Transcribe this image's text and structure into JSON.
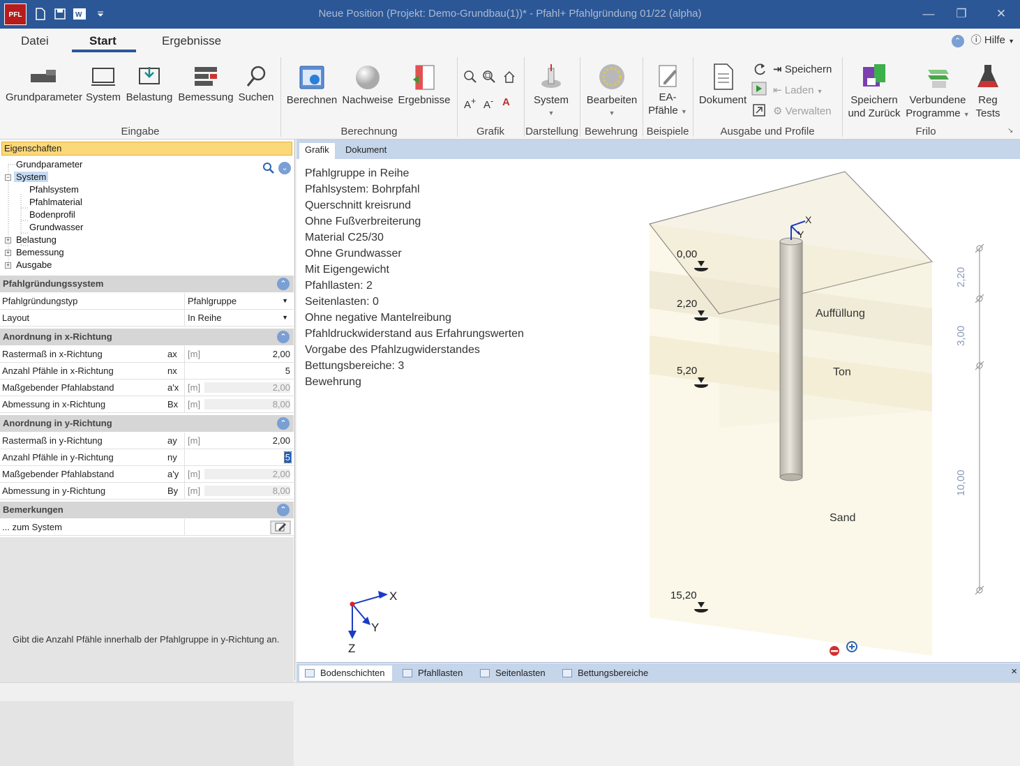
{
  "app": {
    "logo": "PFL",
    "title": "Neue Position (Projekt: Demo-Grundbau(1))* - Pfahl+ Pfahlgründung 01/22 (alpha)"
  },
  "menu": {
    "tabs": [
      "Datei",
      "Start",
      "Ergebnisse"
    ],
    "active": "Start",
    "help": "Hilfe"
  },
  "ribbon": {
    "eingabe": {
      "group": "Eingabe",
      "buttons": [
        "Grundparameter",
        "System",
        "Belastung",
        "Bemessung",
        "Suchen"
      ]
    },
    "berechnung": {
      "group": "Berechnung",
      "buttons": [
        "Berechnen",
        "Nachweise",
        "Ergebnisse"
      ]
    },
    "grafik": {
      "group": "Grafik"
    },
    "darstellung": {
      "group": "Darstellung",
      "button": "System"
    },
    "bewehrung": {
      "group": "Bewehrung",
      "button": "Bearbeiten"
    },
    "beispiele": {
      "group": "Beispiele",
      "button_line1": "EA-",
      "button_line2": "Pfähle"
    },
    "ausgabe": {
      "group": "Ausgabe und Profile",
      "dokument": "Dokument",
      "speichern": "Speichern",
      "laden": "Laden",
      "verwalten": "Verwalten"
    },
    "frilo": {
      "group": "Frilo",
      "b1_line1": "Speichern",
      "b1_line2": "und Zurück",
      "b2_line1": "Verbundene",
      "b2_line2": "Programme",
      "b3_line1": "Reg",
      "b3_line2": "Tests"
    }
  },
  "panel": {
    "header": "Eigenschaften",
    "tree": {
      "grundparameter": "Grundparameter",
      "system": "System",
      "pfahlsystem": "Pfahlsystem",
      "pfahlmaterial": "Pfahlmaterial",
      "bodenprofil": "Bodenprofil",
      "grundwasser": "Grundwasser",
      "belastung": "Belastung",
      "bemessung": "Bemessung",
      "ausgabe": "Ausgabe"
    },
    "sections": {
      "system": "Pfahlgründungssystem",
      "x": "Anordnung in x-Richtung",
      "y": "Anordnung in y-Richtung",
      "bem": "Bemerkungen"
    },
    "system_rows": [
      {
        "label": "Pfahlgründungstyp",
        "value": "Pfahlgruppe"
      },
      {
        "label": "Layout",
        "value": "In Reihe"
      }
    ],
    "x_rows": [
      {
        "label": "Rastermaß in x-Richtung",
        "sym": "ax",
        "unit": "[m]",
        "value": "2,00"
      },
      {
        "label": "Anzahl Pfähle in x-Richtung",
        "sym": "nx",
        "unit": "",
        "value": "5"
      },
      {
        "label": "Maßgebender Pfahlabstand",
        "sym": "a'x",
        "unit": "[m]",
        "value": "2,00"
      },
      {
        "label": "Abmessung in x-Richtung",
        "sym": "Bx",
        "unit": "[m]",
        "value": "8,00"
      }
    ],
    "y_rows": [
      {
        "label": "Rastermaß in y-Richtung",
        "sym": "ay",
        "unit": "[m]",
        "value": "2,00"
      },
      {
        "label": "Anzahl Pfähle in y-Richtung",
        "sym": "ny",
        "unit": "",
        "value": "5"
      },
      {
        "label": "Maßgebender Pfahlabstand",
        "sym": "a'y",
        "unit": "[m]",
        "value": "2,00"
      },
      {
        "label": "Abmessung in y-Richtung",
        "sym": "By",
        "unit": "[m]",
        "value": "8,00"
      }
    ],
    "bem_row": "... zum System",
    "hint": "Gibt die Anzahl Pfähle innerhalb der Pfahlgruppe in y-Richtung an."
  },
  "graphic": {
    "tabs": [
      "Grafik",
      "Dokument"
    ],
    "props": [
      "Pfahlgruppe in Reihe",
      "Pfahlsystem: Bohrpfahl",
      "Querschnitt kreisrund",
      "Ohne Fußverbreiterung",
      "Material C25/30",
      "Ohne Grundwasser",
      "Mit Eigengewicht",
      "Pfahllasten: 2",
      "Seitenlasten: 0",
      "Ohne negative Mantelreibung",
      "Pfahldruckwiderstand aus Erfahrungswerten",
      "Vorgabe des Pfahlzugwiderstandes",
      "Bettungsbereiche: 3",
      "Bewehrung"
    ],
    "depths": [
      "0,00",
      "2,20",
      "5,20",
      "15,20"
    ],
    "layers": [
      "Auffüllung",
      "Ton",
      "Sand"
    ],
    "dims": [
      "2,20",
      "3,00",
      "10,00"
    ],
    "axes": {
      "x": "X",
      "y": "Y",
      "z": "Z"
    }
  },
  "bottom_tabs": [
    "Bodenschichten",
    "Pfahllasten",
    "Seitenlasten",
    "Bettungsbereiche"
  ],
  "close_symbol": "×"
}
